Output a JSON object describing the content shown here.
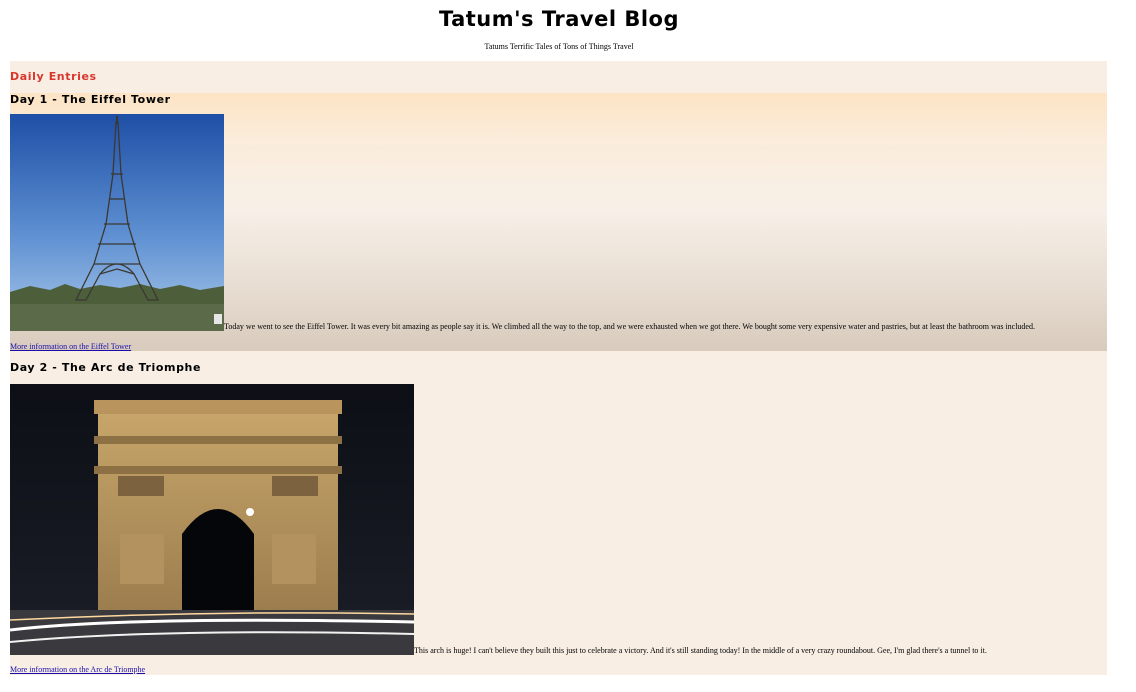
{
  "site": {
    "title": "Tatum's Travel Blog",
    "subtitle": "Tatums Terrific Tales of Tons of Things Travel"
  },
  "section_heading": "Daily Entries",
  "entries": [
    {
      "title": "Day 1 - The Eiffel Tower",
      "image": "eiffel-tower-photo",
      "text": "Today we went to see the Eiffel Tower. It was every bit amazing as people say it is. We climbed all the way to the top, and we were exhausted when we got there. We bought some very expensive water and pastries, but at least the bathroom was included.",
      "link": "More information on the Eiffel Tower"
    },
    {
      "title": "Day 2 - The Arc de Triomphe",
      "image": "arc-de-triomphe-photo",
      "text": "This arch is huge! I can't believe they built this just to celebrate a victory. And it's still standing today! In the middle of a very crazy roundabout. Gee, I'm glad there's a tunnel to it.",
      "link": "More information on the Arc de Triomphe"
    }
  ],
  "colors": {
    "heading_accent": "#d9362d",
    "link": "#1a0dab",
    "panel_background": "#f8eee4"
  }
}
